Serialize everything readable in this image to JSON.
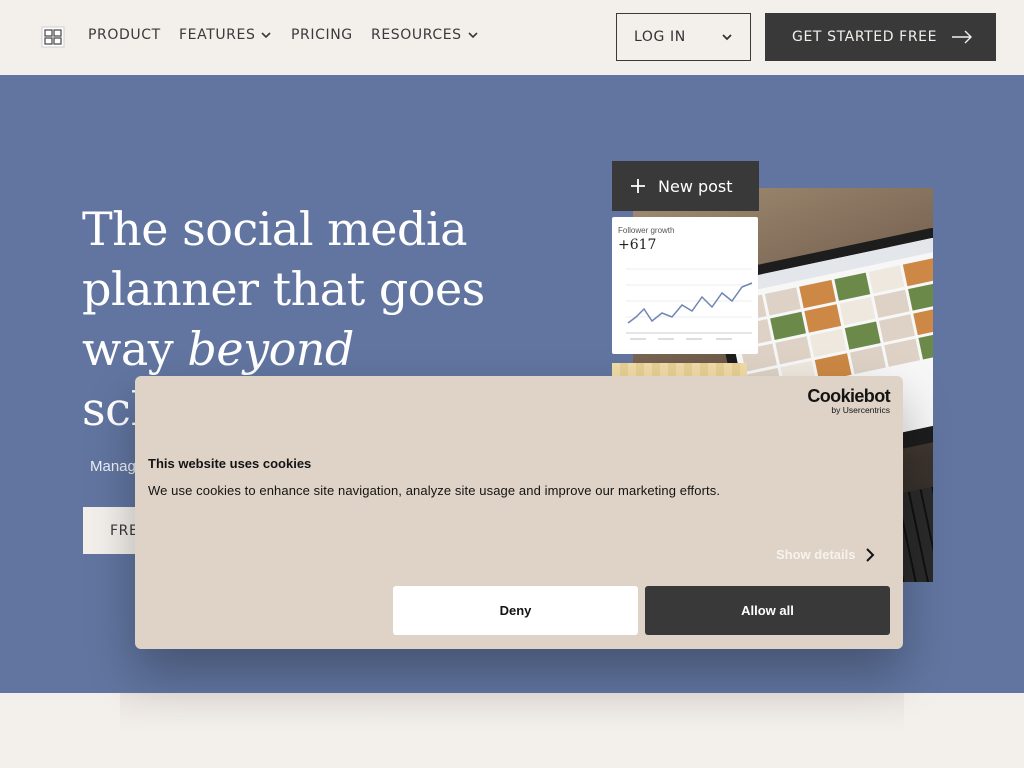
{
  "nav": {
    "logo_icon": "grid-logo-icon",
    "links": [
      {
        "label": "PRODUCT",
        "has_dropdown": false
      },
      {
        "label": "FEATURES",
        "has_dropdown": true
      },
      {
        "label": "PRICING",
        "has_dropdown": false
      },
      {
        "label": "RESOURCES",
        "has_dropdown": true
      }
    ],
    "login_label": "LOG IN",
    "get_started_label": "GET STARTED FREE"
  },
  "hero": {
    "title_line1": "The social media",
    "title_line2": "planner that goes",
    "title_line3_prefix": "way ",
    "title_line3_emphasis": "beyond",
    "title_line4": "sch",
    "subtitle": "Manag",
    "cta_label": "FRE",
    "new_post_label": "New post",
    "growth_card": {
      "label": "Follower growth",
      "value": "+617"
    }
  },
  "cookie": {
    "brand": "Cookiebot",
    "brand_sub": "by Usercentrics",
    "title": "This website uses cookies",
    "text": "We use cookies to enhance site navigation, analyze site usage and improve our marketing efforts.",
    "show_details_label": "Show details",
    "deny_label": "Deny",
    "allow_label": "Allow all"
  },
  "colors": {
    "page_bg": "#f3efeb",
    "hero_bg": "#6175a0",
    "dark_button": "#393939",
    "cookie_bg": "#ded3c6"
  }
}
